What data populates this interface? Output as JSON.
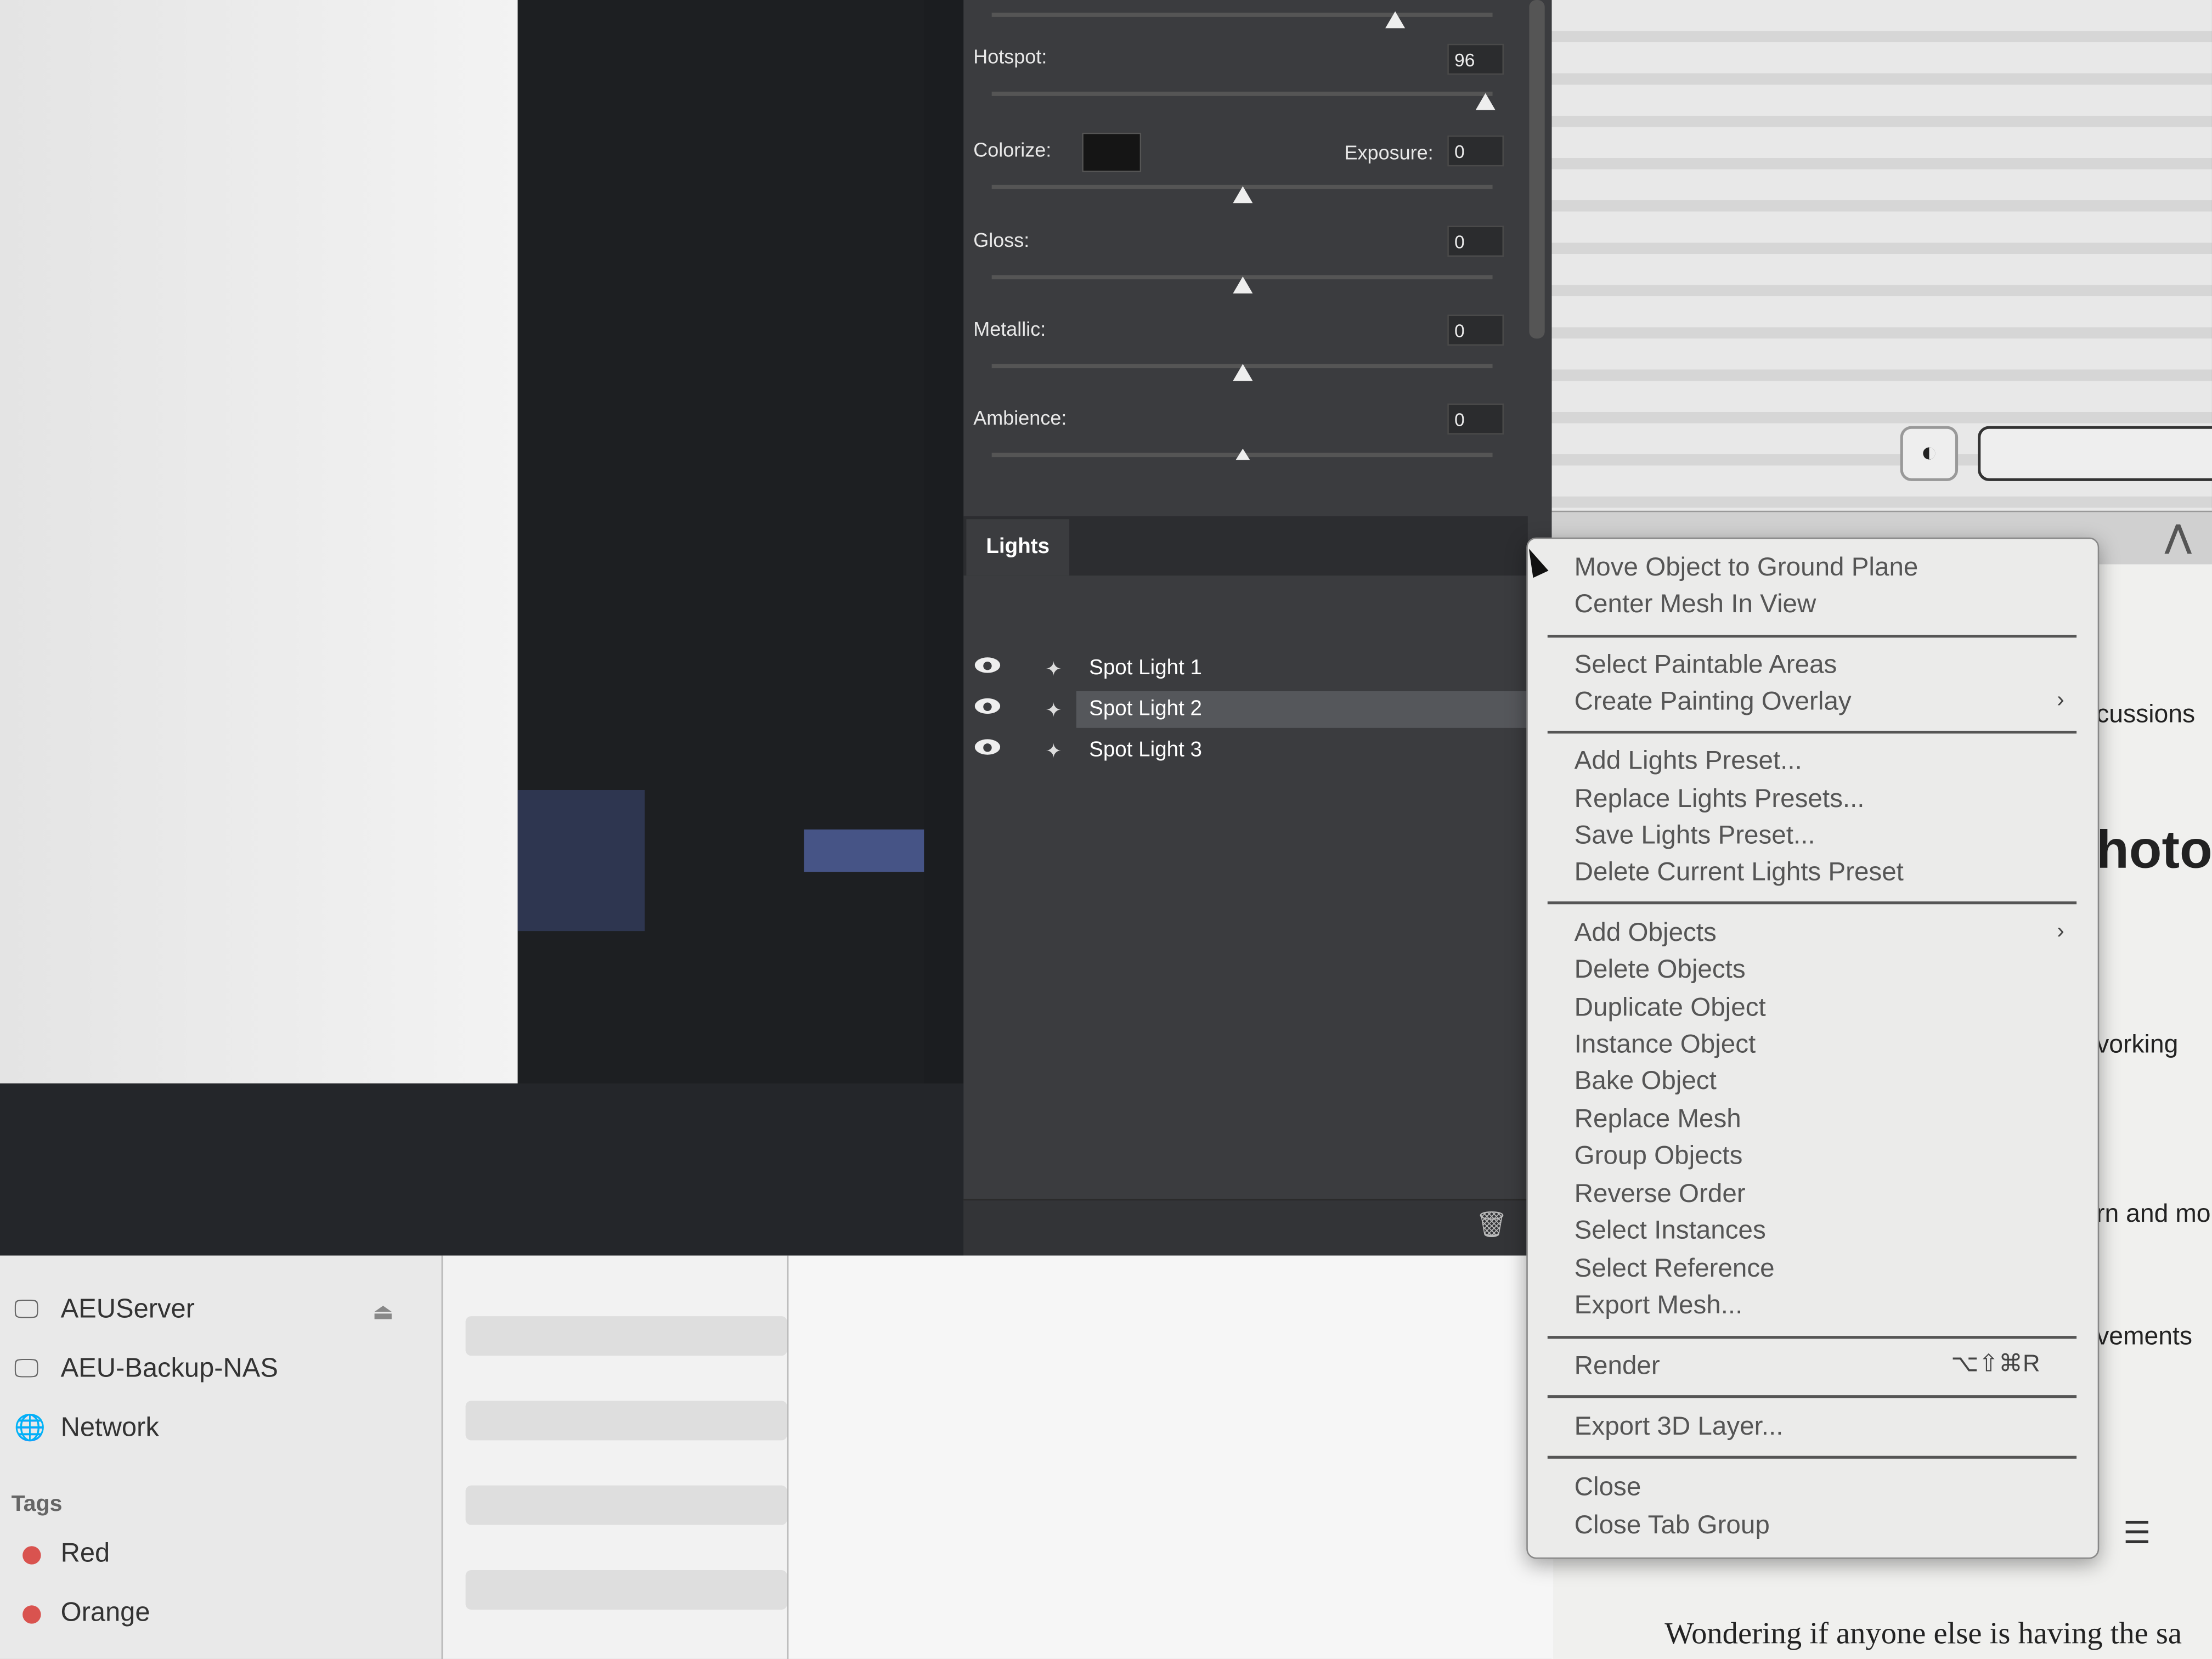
{
  "properties": {
    "hotspot": {
      "label": "Hotspot:",
      "value": "96",
      "slider": 0.96
    },
    "colorize": {
      "label": "Colorize:",
      "color": "#151515"
    },
    "exposure": {
      "label": "Exposure:",
      "value": "0",
      "slider": 0.5
    },
    "gloss": {
      "label": "Gloss:",
      "value": "0",
      "slider": 0.5
    },
    "metallic": {
      "label": "Metallic:",
      "value": "0",
      "slider": 0.5
    },
    "ambience": {
      "label": "Ambience:",
      "value": "0",
      "slider": 0.5
    }
  },
  "lights_panel": {
    "tab": "Lights",
    "items": [
      {
        "name": "Spot Light 1",
        "selected": false
      },
      {
        "name": "Spot Light 2",
        "selected": true
      },
      {
        "name": "Spot Light 3",
        "selected": false
      }
    ],
    "delete_icon": "trash-icon"
  },
  "context_menu": {
    "groups": [
      [
        "Move Object to Ground Plane",
        "Center Mesh In View"
      ],
      [
        "Select Paintable Areas",
        "Create Painting Overlay"
      ],
      [
        "Add Lights Preset...",
        "Replace Lights Presets...",
        "Save Lights Preset...",
        "Delete Current Lights Preset"
      ],
      [
        "Add Objects",
        "Delete Objects",
        "Duplicate Object",
        "Instance Object",
        "Bake Object",
        "Replace Mesh",
        "Group Objects",
        "Reverse Order",
        "Select Instances",
        "Select Reference",
        "Export Mesh..."
      ],
      [
        "Render"
      ],
      [
        "Export 3D Layer..."
      ],
      [
        "Close",
        "Close Tab Group"
      ]
    ],
    "render_shortcut": "⌥⇧⌘R"
  },
  "finder": {
    "locations": [
      "AEUServer",
      "AEU-Backup-NAS",
      "Network"
    ],
    "tags_header": "Tags",
    "tags": [
      {
        "name": "Red",
        "color": "#d9534f"
      },
      {
        "name": "Orange",
        "color": "#d9534f"
      }
    ]
  },
  "web": {
    "fragments": [
      "cussions",
      "hotos",
      "vorking",
      "rn and mo",
      "vements"
    ],
    "post_text": "Wondering if anyone else is having the sa"
  }
}
